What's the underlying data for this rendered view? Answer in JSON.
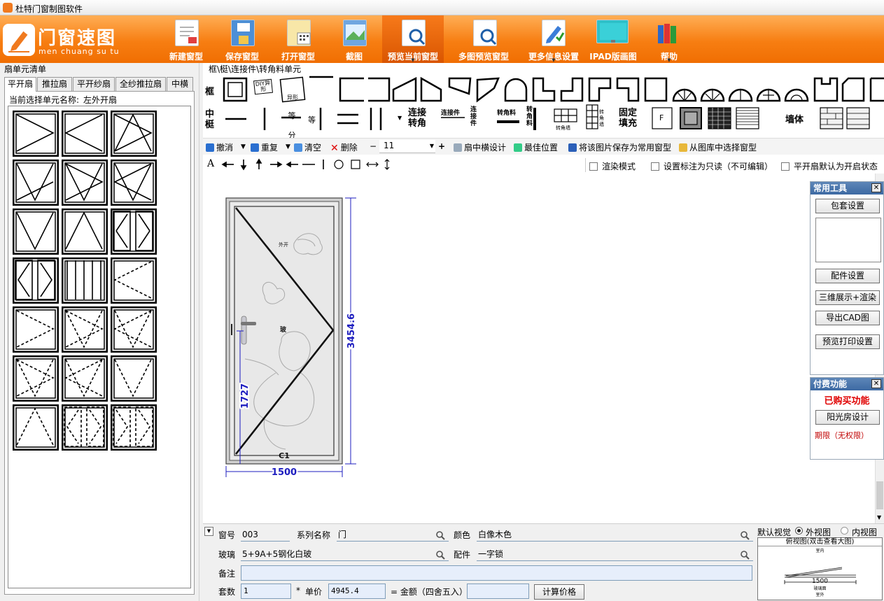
{
  "window": {
    "title": "杜特门窗制图软件"
  },
  "logo": {
    "title": "门窗速图",
    "subtitle": "men chuang su tu"
  },
  "toolbar": {
    "items": [
      {
        "label": "新建窗型",
        "icon": "new-document-icon"
      },
      {
        "label": "保存窗型",
        "icon": "save-icon"
      },
      {
        "label": "打开窗型",
        "icon": "open-icon"
      },
      {
        "label": "截图",
        "icon": "screenshot-icon"
      },
      {
        "label": "预览当前窗型",
        "icon": "preview-icon"
      },
      {
        "label": "多图预览窗型",
        "icon": "multi-preview-icon"
      },
      {
        "label": "更多信息设置",
        "icon": "settings-icon"
      },
      {
        "label": "IPAD版画图",
        "icon": "ipad-icon"
      },
      {
        "label": "帮助",
        "icon": "help-books-icon"
      }
    ]
  },
  "left_panel": {
    "title": "扇单元清单",
    "tabs": [
      "平开扇",
      "推拉扇",
      "平开纱扇",
      "全纱推拉扇",
      "中横"
    ],
    "current_label": "当前选择单元名称:",
    "current_value": "左外开扇"
  },
  "components": {
    "label": "框\\梃\\连接件\\转角料单元",
    "frame_label": "框",
    "mullion_label": "中梃",
    "diy_label": "DIY异形",
    "special_label": "异形",
    "equal_label": "等分",
    "equal2_label": "等",
    "connector_label": "连接转角",
    "connector_part": "连接件",
    "connector_vert": "连接件",
    "corner_label": "转角料",
    "corner_vert": "转角料",
    "corner_wall1": "转角墙",
    "corner_wall2": "转角墙",
    "fixed_fill": "固定填充",
    "f_label": "F",
    "wall_label": "墙体"
  },
  "actions": {
    "undo": "撤消",
    "redo": "重复",
    "clear": "清空",
    "delete": "删除",
    "minus": "−",
    "size": "11",
    "plus": "+",
    "sash_transom": "扇中横设计",
    "best_pos": "最佳位置",
    "save_common": "将该图片保存为常用窗型",
    "choose_lib": "从图库中选择窗型"
  },
  "drawtools": {
    "text_tool": "A",
    "options": [
      {
        "label": "渲染模式",
        "checked": false
      },
      {
        "label": "设置标注为只读（不可编辑）",
        "checked": false
      },
      {
        "label": "平开扇默认为开启状态",
        "checked": false
      }
    ]
  },
  "drawing": {
    "width_dim": "1500",
    "height_dim": "3454.6",
    "handle_dim": "1727",
    "window_code": "C1",
    "glass_color": "#e6e6e6",
    "frame_color": "#c8c8c8",
    "dim_color": "#1d1dbf"
  },
  "common_tools": {
    "title": "常用工具",
    "buttons": [
      "包套设置",
      "配件设置",
      "三维展示+渲染",
      "导出CAD图",
      "预览打印设置"
    ]
  },
  "paid": {
    "title": "付费功能",
    "purchased": "已购买功能",
    "sunroom": "阳光房设计",
    "period": "期限（无权限）"
  },
  "form": {
    "window_no_label": "窗号",
    "window_no": "003",
    "series_label": "系列名称",
    "series": "门",
    "color_label": "颜色",
    "color": "白像木色",
    "glass_label": "玻璃",
    "glass": "5+9A+5钢化白玻",
    "fitting_label": "配件",
    "fitting": "一字锁",
    "note_label": "备注",
    "note": "",
    "sets_label": "套数",
    "sets": "1",
    "mult": "*",
    "price_label": "单价",
    "price": "4945.4",
    "amount_label": "= 金额（四舍五入）",
    "amount": "",
    "calc_button": "计算价格"
  },
  "view": {
    "label": "默认视觉",
    "outer": "外视图",
    "inner": "内视图",
    "thumb_title": "俯视图(双击查看大图)",
    "thumb_top": "室内",
    "thumb_dim": "1500",
    "thumb_glass": "玻璃面",
    "thumb_bottom": "室外"
  }
}
